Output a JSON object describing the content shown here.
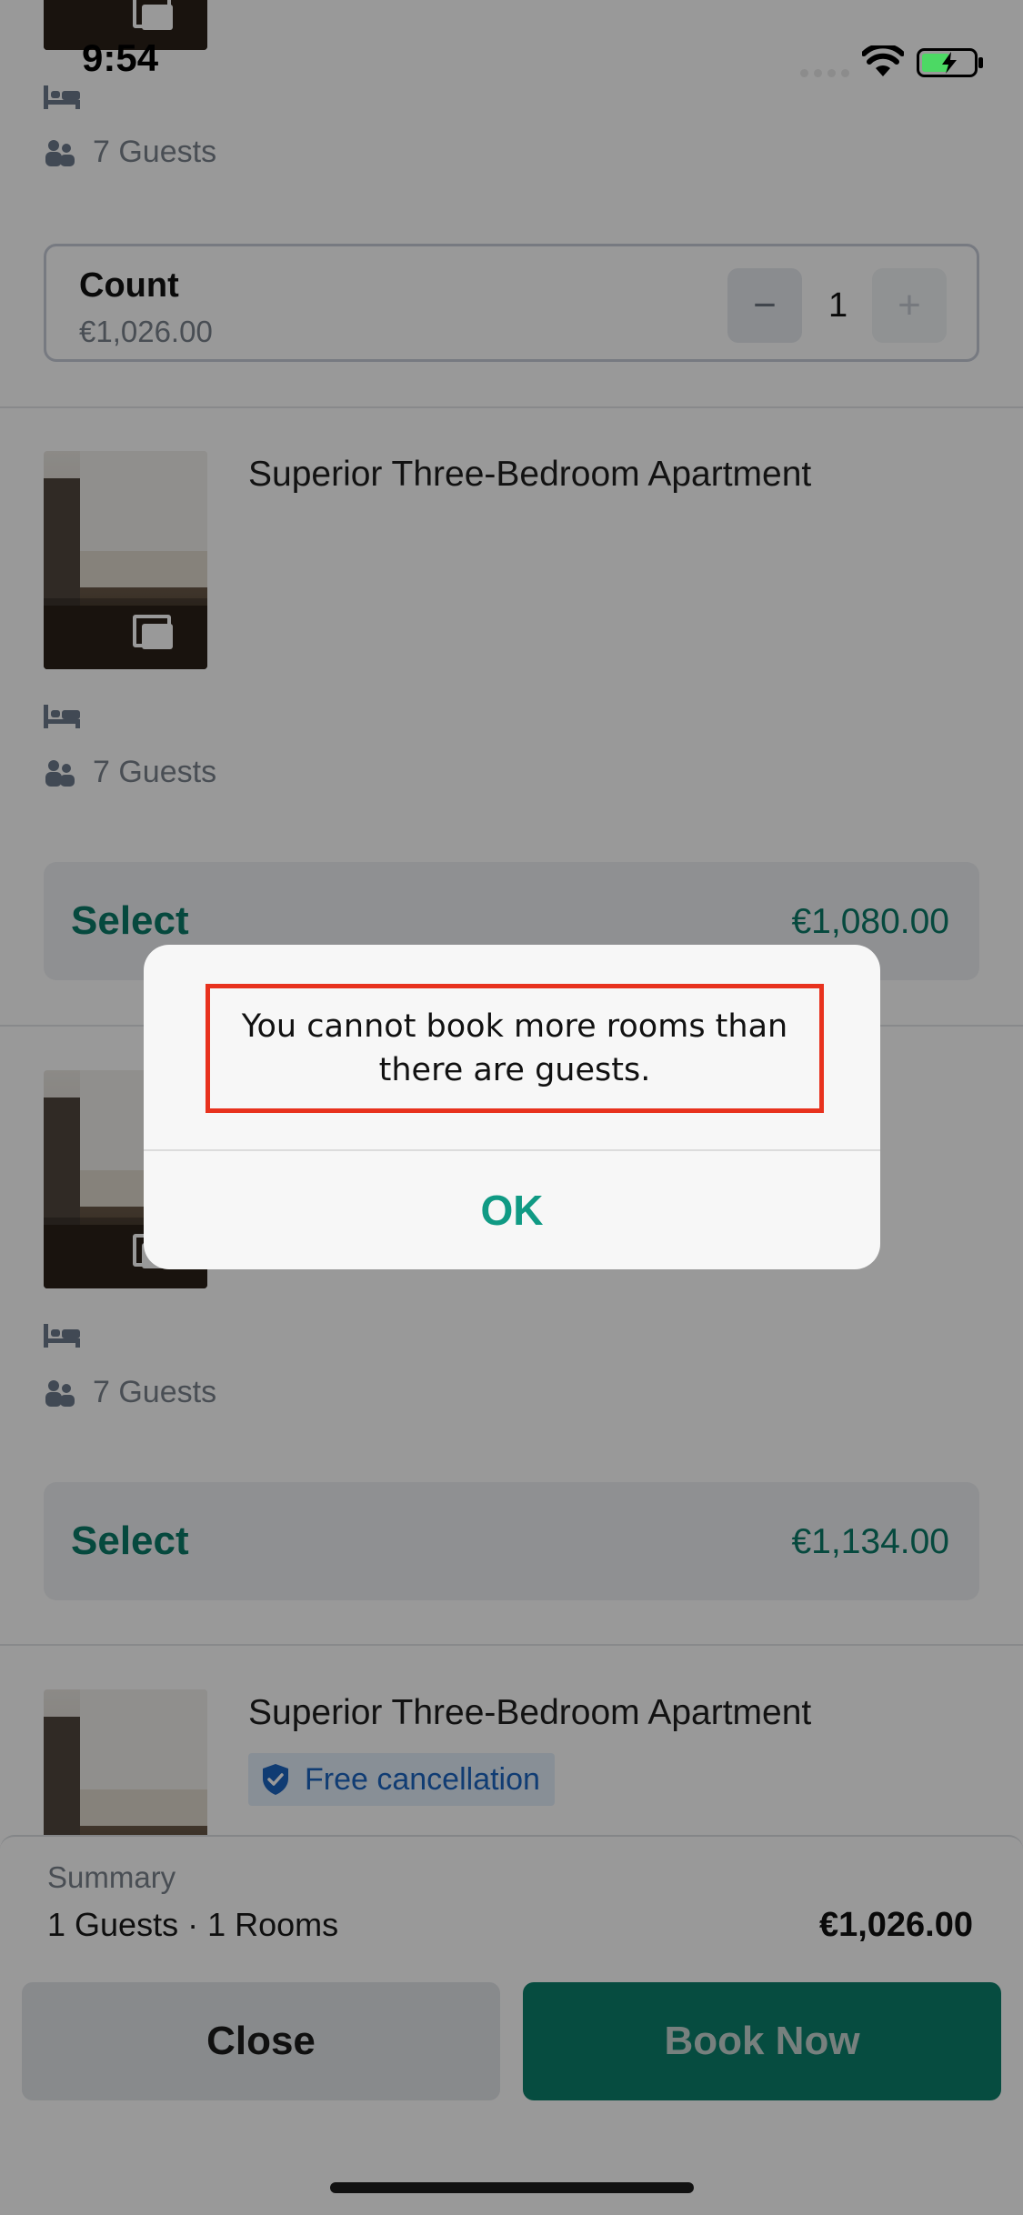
{
  "status_bar": {
    "time": "9:54"
  },
  "rooms": [
    {
      "guests": "7 Guests",
      "count_label": "Count",
      "count_price": "€1,026.00",
      "count_value": "1",
      "minus": "−",
      "plus": "+"
    },
    {
      "title": "Superior Three-Bedroom Apartment",
      "guests": "7 Guests",
      "select_label": "Select",
      "price": "€1,080.00"
    },
    {
      "guests": "7 Guests",
      "select_label": "Select",
      "price": "€1,134.00"
    },
    {
      "title": "Superior Three-Bedroom Apartment",
      "badge": "Free cancellation"
    }
  ],
  "summary": {
    "label": "Summary",
    "detail": "1 Guests · 1 Rooms",
    "total": "€1,026.00"
  },
  "actions": {
    "close": "Close",
    "book": "Book Now"
  },
  "alert": {
    "message": "You cannot book more rooms than there are guests.",
    "ok": "OK"
  },
  "colors": {
    "accent": "#0b7f6b",
    "highlight_border": "#e8321e",
    "badge_text": "#1c64c0"
  }
}
